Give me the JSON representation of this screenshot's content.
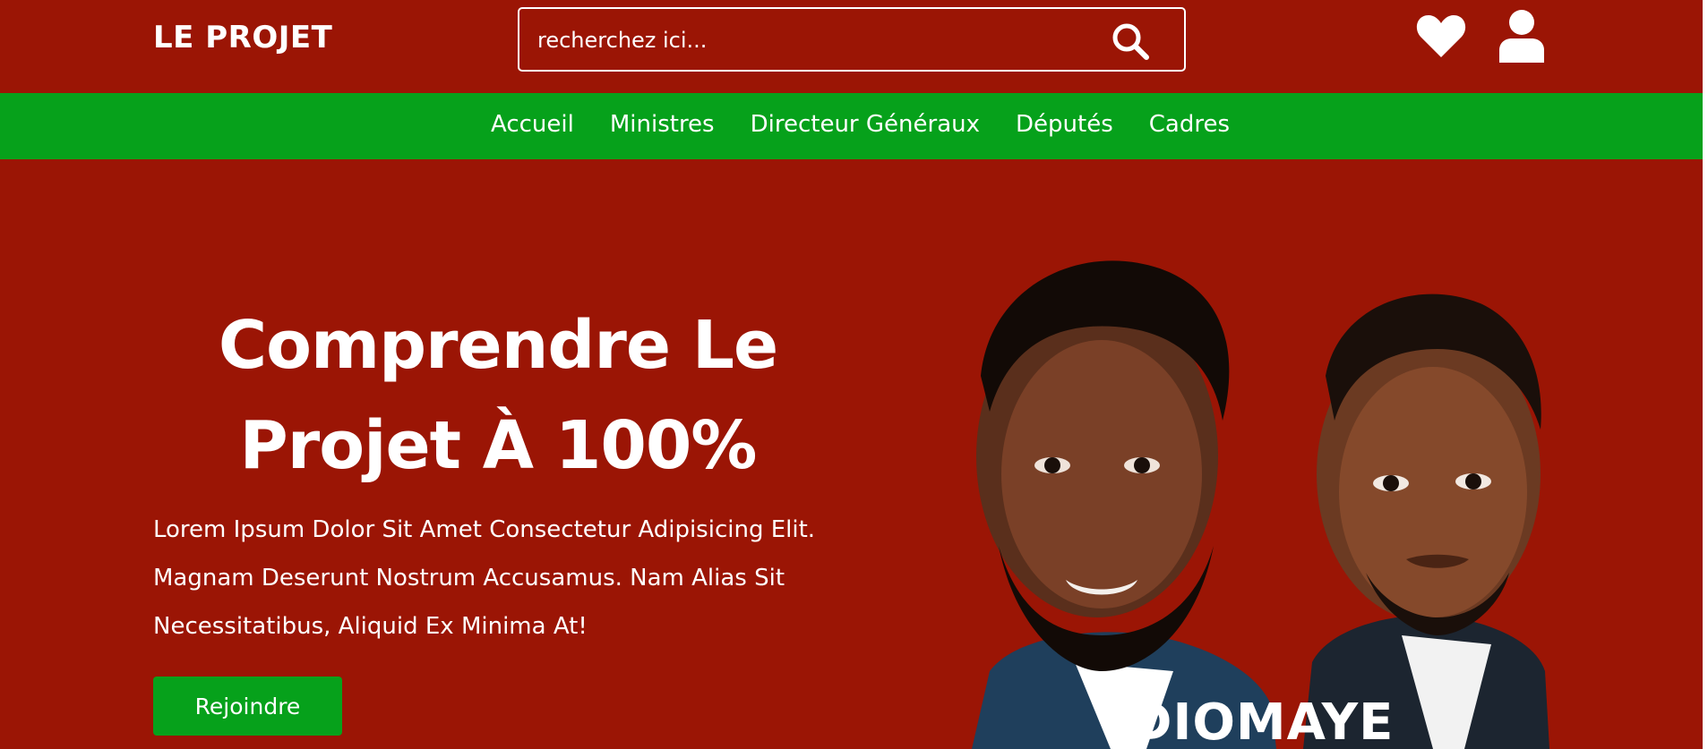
{
  "header": {
    "logo": "LE PROJET",
    "search": {
      "placeholder": "recherchez ici..."
    },
    "icons": [
      "search-icon",
      "heart-icon",
      "user-icon"
    ]
  },
  "nav": {
    "items": [
      {
        "label": "Accueil"
      },
      {
        "label": "Ministres"
      },
      {
        "label": "Directeur Généraux"
      },
      {
        "label": "Députés"
      },
      {
        "label": "Cadres"
      }
    ]
  },
  "hero": {
    "title_line1": "Comprendre Le",
    "title_line2": "Projet À 100%",
    "text_line1": "Lorem Ipsum Dolor Sit Amet Consectetur Adipisicing Elit.",
    "text_line2": "Magnam Deserunt Nostrum Accusamus. Nam Alias Sit",
    "text_line3": "Necessitatibus, Aliquid Ex Minima At!",
    "button_label": "Rejoindre",
    "image_caption": "DIOMAYE"
  },
  "colors": {
    "primary_red": "#9b1505",
    "accent_green": "#06a11b",
    "text": "#ffffff"
  }
}
